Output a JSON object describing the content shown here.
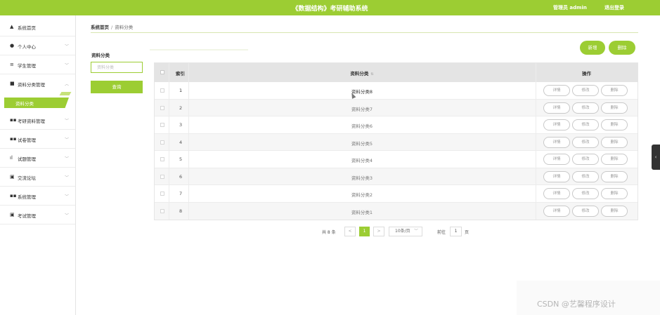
{
  "header": {
    "title": "《数据结构》考研辅助系统",
    "admin_text": "管理员 admin",
    "logout_label": "退出登录"
  },
  "sidebar": {
    "items": [
      {
        "label": "系统首页",
        "icon": "home-icon"
      },
      {
        "label": "个人中心",
        "icon": "user-icon"
      },
      {
        "label": "学生管理",
        "icon": "list-icon"
      },
      {
        "label": "资料分类管理",
        "icon": "folder-icon"
      },
      {
        "label": "考研资料管理",
        "icon": "grid-icon"
      },
      {
        "label": "试卷管理",
        "icon": "grid-icon"
      },
      {
        "label": "试题管理",
        "icon": "bar-icon"
      },
      {
        "label": "交流论坛",
        "icon": "book-icon"
      },
      {
        "label": "系统管理",
        "icon": "grid-icon"
      },
      {
        "label": "考试管理",
        "icon": "book-icon"
      }
    ],
    "active_sub": "资料分类"
  },
  "breadcrumb": {
    "home": "系统首页",
    "separator": "/",
    "current": "资料分类"
  },
  "filter": {
    "label": "资料分类",
    "placeholder": "资料分类",
    "query_label": "查询"
  },
  "actions": {
    "add_label": "新增",
    "delete_label": "删除"
  },
  "table": {
    "headers": {
      "index": "索引",
      "category": "资料分类",
      "ops": "操作"
    },
    "row_buttons": {
      "detail": "详情",
      "edit": "修改",
      "delete": "删除"
    },
    "rows": [
      {
        "index": "1",
        "category": "资料分类8"
      },
      {
        "index": "2",
        "category": "资料分类7"
      },
      {
        "index": "3",
        "category": "资料分类6"
      },
      {
        "index": "4",
        "category": "资料分类5"
      },
      {
        "index": "5",
        "category": "资料分类4"
      },
      {
        "index": "6",
        "category": "资料分类3"
      },
      {
        "index": "7",
        "category": "资料分类2"
      },
      {
        "index": "8",
        "category": "资料分类1"
      }
    ]
  },
  "pagination": {
    "total": "共 8 条",
    "prev": "<",
    "current_page": "1",
    "next": ">",
    "page_size": "10条/页",
    "goto_label": "前往",
    "goto_value": "1",
    "page_unit": "页"
  },
  "watermark": "CSDN @艺馨程序设计",
  "colors": {
    "accent": "#9ccd33"
  }
}
